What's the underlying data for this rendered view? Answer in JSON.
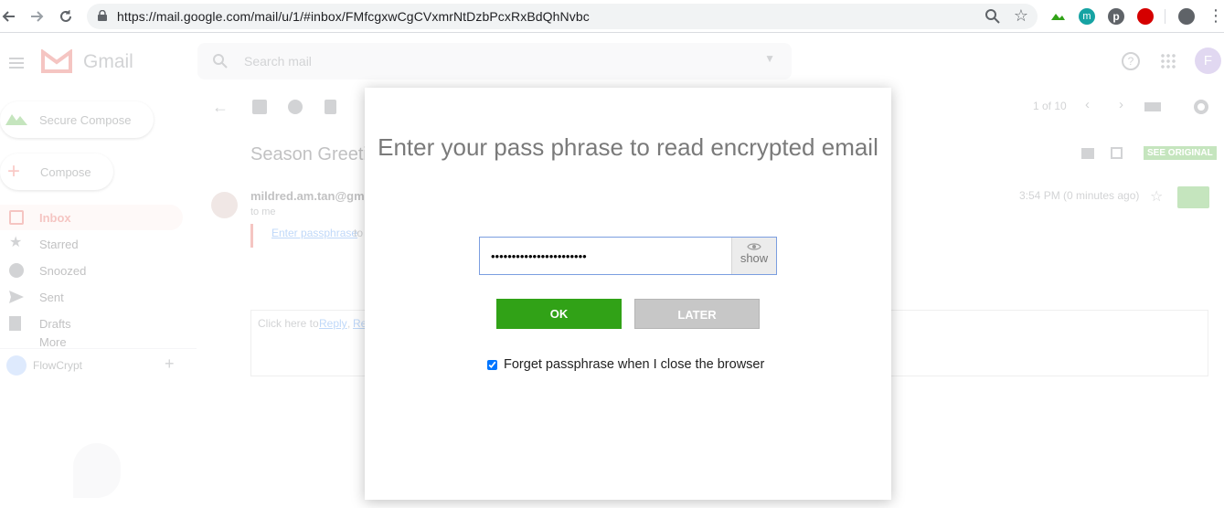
{
  "browser": {
    "url": "https://mail.google.com/mail/u/1/#inbox/FMfcgxwCgCVxmrNtDzbPcxRxBdQhNvbc"
  },
  "gmail": {
    "logo_text": "Gmail",
    "search_placeholder": "Search mail",
    "avatar_letter": "F",
    "secure_compose": "Secure Compose",
    "compose": "Compose",
    "nav": [
      "Inbox",
      "Starred",
      "Snoozed",
      "Sent",
      "Drafts",
      "More"
    ],
    "account_label": "FlowCrypt",
    "pager": "1 of 10",
    "subject": "Season Greeti",
    "sender": "mildred.am.tan@gma",
    "to_me": "to me",
    "enter_passphrase_link": "Enter passphrase",
    "enter_passphrase_suffix": " to",
    "time": "3:54 PM (0 minutes ago)",
    "see_original": "SEE ORIGINAL",
    "reply_prefix": "Click here to ",
    "reply_link": "Reply",
    "reply_sep": ", ",
    "reply_link2": "Re"
  },
  "modal": {
    "title": "Enter your pass phrase to read encrypted email",
    "passphrase_value": "•••••••••••••••••••••••",
    "show_label": "show",
    "ok_label": "OK",
    "later_label": "LATER",
    "forget_label": "Forget passphrase when I close the browser",
    "forget_checked": true
  },
  "colors": {
    "ok_button": "#31a217",
    "later_button": "#c7c7c7",
    "input_border": "#7b9ee0"
  }
}
